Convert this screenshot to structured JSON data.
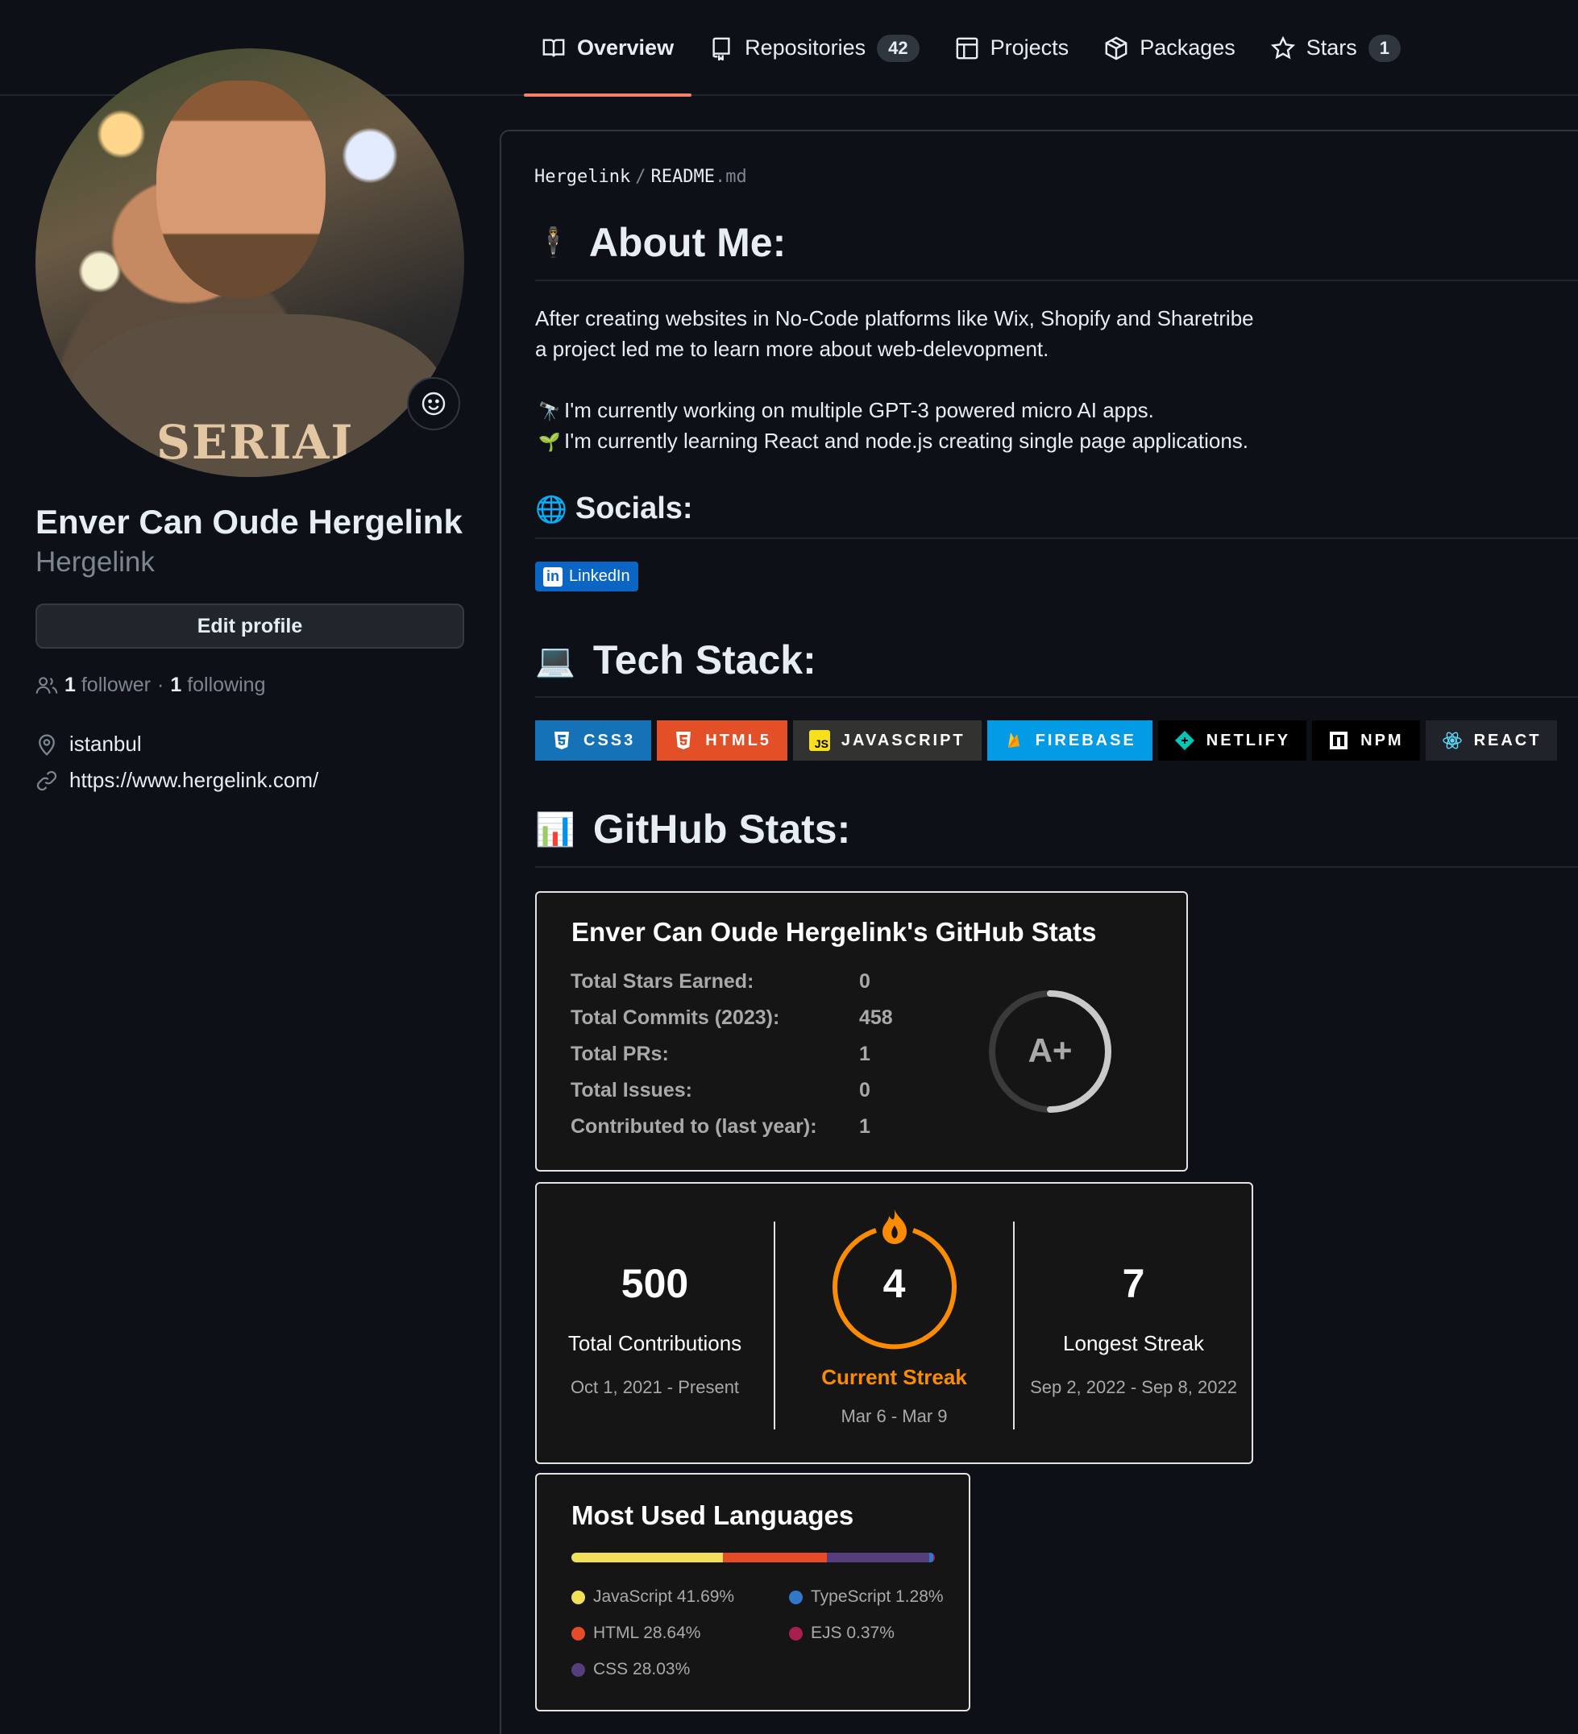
{
  "nav": {
    "tabs": [
      {
        "label": "Overview",
        "icon": "book-icon",
        "active": true
      },
      {
        "label": "Repositories",
        "icon": "repo-icon",
        "count": "42"
      },
      {
        "label": "Projects",
        "icon": "table-icon"
      },
      {
        "label": "Packages",
        "icon": "package-icon"
      },
      {
        "label": "Stars",
        "icon": "star-icon",
        "count": "1"
      }
    ]
  },
  "profile": {
    "full_name": "Enver Can Oude Hergelink",
    "username": "Hergelink",
    "edit_label": "Edit profile",
    "followers_count": "1",
    "followers_label": "follower",
    "following_count": "1",
    "following_label": "following",
    "separator": "·",
    "location": "istanbul",
    "website": "https://www.hergelink.com/",
    "avatar_shirt_text": "SERIAL"
  },
  "readme": {
    "crumb_user": "Hergelink",
    "crumb_sep": "/",
    "crumb_file": "README",
    "crumb_ext": ".md",
    "about": {
      "emoji": "🕴",
      "title": "About Me:",
      "line1": "After creating websites in No-Code platforms like Wix, Shopify and Sharetribe",
      "line2": "a project led me to learn more about web-delevopment.",
      "working_emoji": "🔭",
      "working": "I'm currently working on multiple GPT-3 powered micro AI apps.",
      "learning_emoji": "🌱",
      "learning": "I'm currently learning React and node.js creating single page applications."
    },
    "socials": {
      "emoji": "🌐",
      "title": "Socials:",
      "linkedin_label": "LinkedIn",
      "linkedin_color": "#0a66c2"
    },
    "tech": {
      "emoji": "💻",
      "title": "Tech Stack:",
      "badges": [
        {
          "label": "CSS3",
          "bg": "#1572b6",
          "icon": "css3-icon"
        },
        {
          "label": "HTML5",
          "bg": "#e34f26",
          "icon": "html5-icon"
        },
        {
          "label": "JAVASCRIPT",
          "bg": "#323330",
          "icon": "javascript-icon"
        },
        {
          "label": "FIREBASE",
          "bg": "#039be5",
          "icon": "firebase-icon"
        },
        {
          "label": "NETLIFY",
          "bg": "#000000",
          "icon": "netlify-icon"
        },
        {
          "label": "NPM",
          "bg": "#000000",
          "icon": "npm-icon"
        },
        {
          "label": "REACT",
          "bg": "#20232a",
          "icon": "react-icon"
        }
      ]
    },
    "stats_heading": {
      "emoji": "📊",
      "title": "GitHub Stats:"
    }
  },
  "stats_card": {
    "title": "Enver Can Oude Hergelink's GitHub Stats",
    "rows": [
      {
        "label": "Total Stars Earned:",
        "value": "0"
      },
      {
        "label": "Total Commits (2023):",
        "value": "458"
      },
      {
        "label": "Total PRs:",
        "value": "1"
      },
      {
        "label": "Total Issues:",
        "value": "0"
      },
      {
        "label": "Contributed to (last year):",
        "value": "1"
      }
    ],
    "rank": "A+"
  },
  "streak_card": {
    "total": {
      "value": "500",
      "label": "Total Contributions",
      "range": "Oct 1, 2021 - Present"
    },
    "current": {
      "value": "4",
      "label": "Current Streak",
      "range": "Mar 6 - Mar 9",
      "color": "#fb8c00"
    },
    "longest": {
      "value": "7",
      "label": "Longest Streak",
      "range": "Sep 2, 2022 - Sep 8, 2022"
    }
  },
  "langs_card": {
    "title": "Most Used Languages",
    "languages": [
      {
        "name": "JavaScript",
        "percent": 41.69,
        "display": "JavaScript 41.69%",
        "color": "#f1e05a"
      },
      {
        "name": "HTML",
        "percent": 28.64,
        "display": "HTML 28.64%",
        "color": "#e34c26"
      },
      {
        "name": "CSS",
        "percent": 28.03,
        "display": "CSS 28.03%",
        "color": "#563d7c"
      },
      {
        "name": "TypeScript",
        "percent": 1.28,
        "display": "TypeScript 1.28%",
        "color": "#3178c6"
      },
      {
        "name": "EJS",
        "percent": 0.37,
        "display": "EJS 0.37%",
        "color": "#a91e50"
      }
    ]
  }
}
